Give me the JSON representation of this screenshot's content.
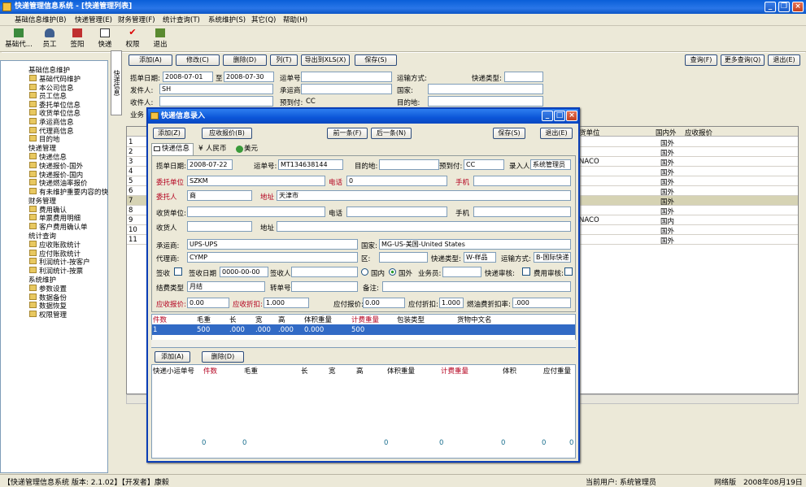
{
  "window": {
    "title": "快递管理信息系统 - [快递管理列表]"
  },
  "menu": [
    "基础信息维护(B)",
    "快递管理(E)",
    "财务管理(F)",
    "统计查询(T)",
    "系统维护(S)",
    "其它(Q)",
    "帮助(H)"
  ],
  "toolbar": [
    "基础代...",
    "员工",
    "签阳",
    "快递",
    "权限",
    "退出"
  ],
  "tree": {
    "g1": "基础信息维护",
    "g1_items": [
      "基础代码维护",
      "本公司信息",
      "员工信息",
      "委托单位信息",
      "收货单位信息",
      "承运商信息",
      "代理商信息",
      "目的地"
    ],
    "g2": "快递管理",
    "g2_items": [
      "快递信息",
      "快递报价-国外",
      "快递报价-国内",
      "快递燃油率报价",
      "有未维护重要内容的快"
    ],
    "g3": "财务管理",
    "g3_items": [
      "费用确认",
      "单票费用明细",
      "客户费用确认单"
    ],
    "g4": "统计查询",
    "g4_items": [
      "应收账款统计",
      "应付账款统计",
      "利润统计-按客户",
      "利润统计-按票"
    ],
    "g5": "系统维护",
    "g5_items": [
      "参数设置",
      "数据备份",
      "数据恢复",
      "权限管理"
    ]
  },
  "sidetab": "快递信息",
  "list_toolbar": {
    "add": "添加(A)",
    "edit": "修改(C)",
    "del": "删除(D)",
    "col": "列(T)",
    "export": "导出到XLS(X)",
    "save": "保存(S)",
    "query": "查询(F)",
    "more_query": "更多查询(Q)",
    "exit": "退出(E)"
  },
  "filter": {
    "date_label": "揽单日期:",
    "date_from": "2008-07-01",
    "date_to_label": "至",
    "date_to": "2008-07-30",
    "waybill": "运单号:",
    "ship_method": "运输方式:",
    "express_type": "快递类型:",
    "sender": "发件人:",
    "sender_val": "SH",
    "carrier": "承运商:",
    "country": "国家:",
    "receiver": "收件人:",
    "prepaid": "预到付:",
    "prepaid_val": "CC",
    "dest": "目的地:",
    "staff": "业务"
  },
  "grid": {
    "headers": [
      "货单位",
      "国内外",
      "应收报价"
    ],
    "rows": [
      {
        "no": "1",
        "place": "国外",
        "hl": false
      },
      {
        "no": "2",
        "place": "国外",
        "hl": false
      },
      {
        "no": "3",
        "place": "国外",
        "hl": false,
        "unit": "NACO"
      },
      {
        "no": "4",
        "place": "国外",
        "hl": false
      },
      {
        "no": "5",
        "place": "国外",
        "hl": false
      },
      {
        "no": "6",
        "place": "国外",
        "hl": false
      },
      {
        "no": "7",
        "place": "国外",
        "hl": true
      },
      {
        "no": "8",
        "place": "国外",
        "hl": false
      },
      {
        "no": "9",
        "place": "国内",
        "hl": false,
        "unit": "NACO"
      },
      {
        "no": "10",
        "place": "国外",
        "hl": false
      },
      {
        "no": "11",
        "place": "国外",
        "hl": false
      }
    ]
  },
  "dialog": {
    "title": "快递信息录入",
    "top_buttons": {
      "add": "添加(Z)",
      "quote": "应收报价(B)",
      "prev": "前一条(F)",
      "next": "后一条(N)",
      "save": "保存(S)",
      "exit": "退出(E)"
    },
    "tabs": [
      "快递信息",
      "人民币",
      "美元"
    ],
    "fields": {
      "order_date_label": "揽单日期:",
      "order_date": "2008-07-22",
      "waybill_label": "运单号:",
      "waybill": "MT134638144",
      "dest_label": "目的地:",
      "prepaid_label": "预到付:",
      "prepaid": "CC",
      "entry_label": "录入人:",
      "entry": "系统管理员",
      "consignor_label": "委托单位",
      "consignor": "SZKM",
      "phone_label": "电话",
      "phone": "0",
      "mobile_label": "手机",
      "consignor_person_label": "委托人",
      "consignor_person": "商",
      "address_label": "地址",
      "address": "天津市",
      "receiver_unit_label": "收货单位:",
      "phone2_label": "电话",
      "mobile2_label": "手机",
      "receiver_label": "收货人",
      "address2_label": "地址",
      "carrier_label": "承运商:",
      "carrier": "UPS-UPS",
      "country_label": "国家:",
      "country": "MG-US-美国-United States",
      "agent_label": "代理商:",
      "agent": "CYMP",
      "district_label": "区:",
      "express_type_label": "快递类型:",
      "express_type": "W-样品",
      "ship_label": "运输方式:",
      "ship": "B-国际快递",
      "sign_label": "签收",
      "sign_date_label": "签收日期",
      "sign_date": "0000-00-00",
      "signer_label": "签收人",
      "domestic": "国内",
      "foreign": "国外",
      "staff_label": "业务员:",
      "audit_label": "快递审核:",
      "fee_audit_label": "费用审核:",
      "settle_label": "结费类型",
      "settle": "月结",
      "transfer_label": "转单号",
      "note_label": "备注:",
      "recv_quote_label": "应收报价:",
      "recv_quote": "0.00",
      "recv_disc_label": "应收折扣:",
      "recv_disc": "1.000",
      "pay_quote_label": "应付报价:",
      "pay_quote": "0.00",
      "pay_disc_label": "应付折扣:",
      "pay_disc": "1.000",
      "fuel_label": "燃油费折扣率:",
      "fuel": ".000"
    },
    "piece_headers": [
      "件数",
      "毛重",
      "长",
      "宽",
      "高",
      "体积重量",
      "计费重量",
      "包装类型",
      "货物中文名"
    ],
    "piece_row": [
      "1",
      "500",
      ".000",
      ".000",
      ".000",
      "0.000",
      "500",
      "",
      ""
    ],
    "mid_buttons": {
      "add": "添加(A)",
      "del": "删除(D)"
    },
    "sub_headers": [
      "快递小运单号",
      "件数",
      "毛重",
      "长",
      "宽",
      "高",
      "体积重量",
      "计费重量",
      "体积",
      "应付重量"
    ],
    "sub_totals": [
      "0",
      "0",
      "0",
      "0",
      "0",
      "0",
      "0"
    ]
  },
  "status": {
    "version": "【快递管理信息系统 版本: 2.1.02】【开发者】康毅",
    "user": "当前用户: 系统管理员",
    "edition": "网络版",
    "date": "2008年08月19日"
  }
}
